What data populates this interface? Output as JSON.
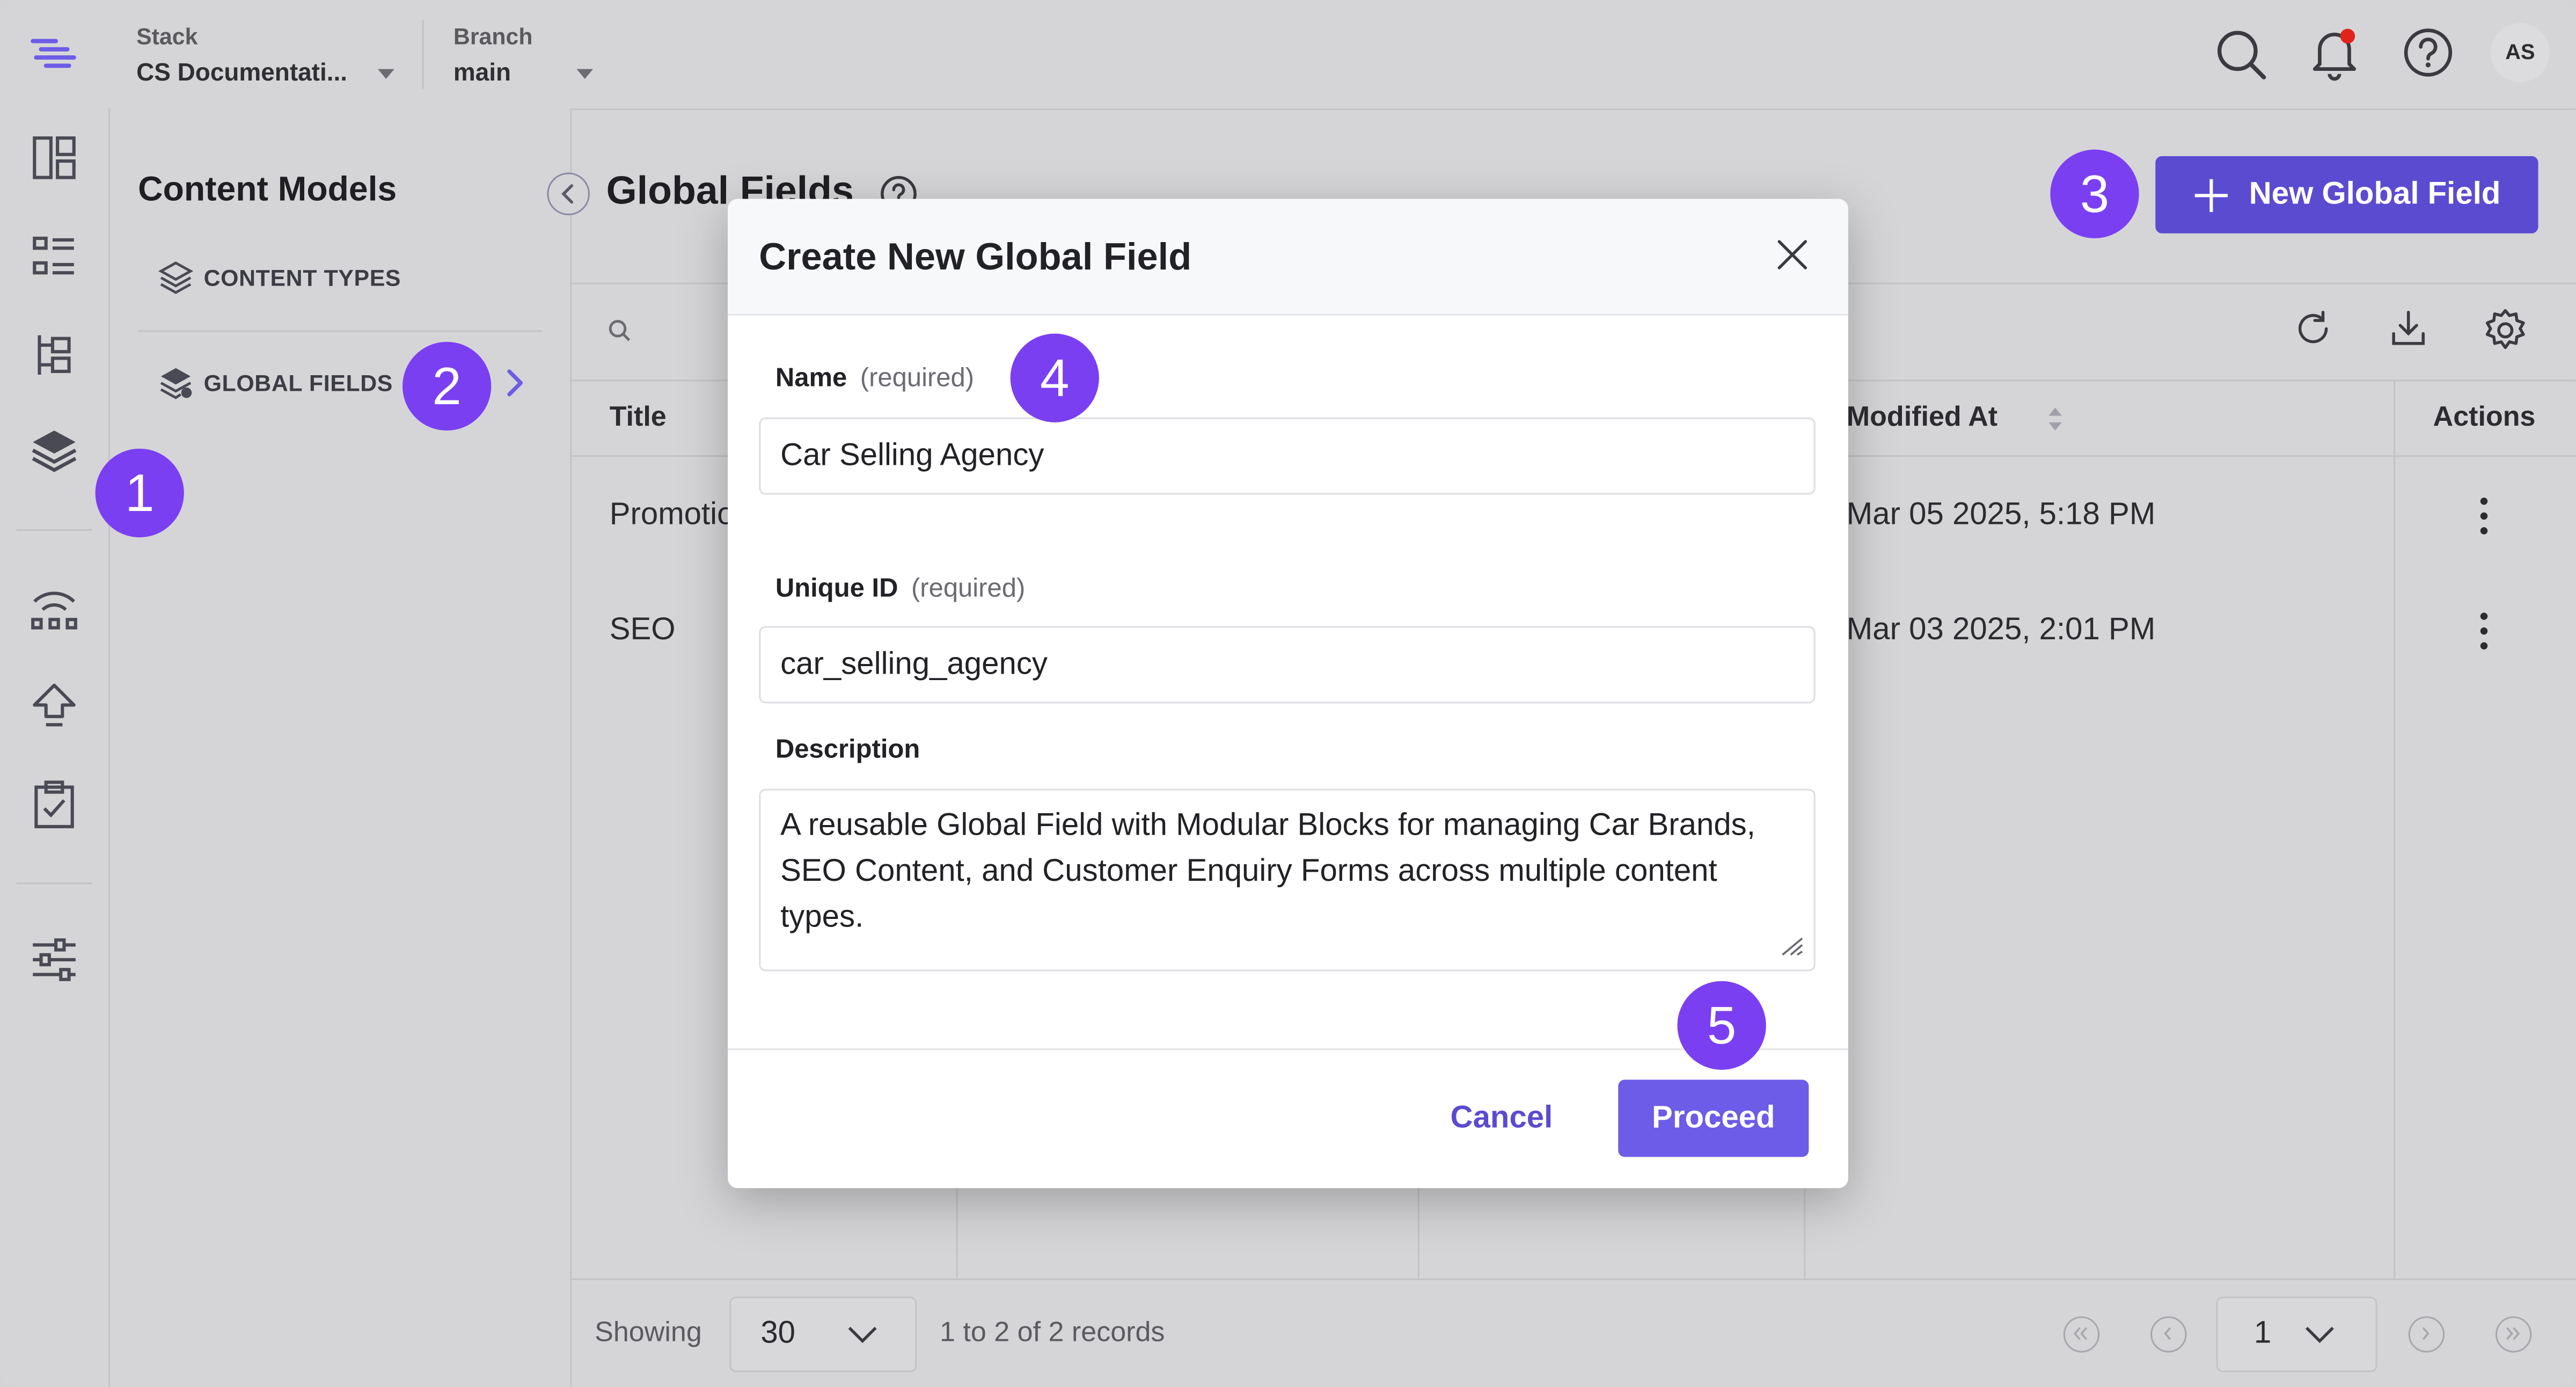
{
  "topbar": {
    "stack_label": "Stack",
    "stack_value": "CS Documentati...",
    "branch_label": "Branch",
    "branch_value": "main",
    "avatar_initials": "AS"
  },
  "sidebar": {
    "title": "Content Models",
    "items": [
      {
        "label": "CONTENT TYPES"
      },
      {
        "label": "GLOBAL FIELDS"
      }
    ]
  },
  "main": {
    "title": "Global Fields",
    "new_button_label": "New Global Field",
    "table": {
      "columns": [
        "Title",
        "Modified At",
        "Actions"
      ],
      "rows": [
        {
          "title": "Promotio",
          "modified": "Mar 05 2025, 5:18 PM"
        },
        {
          "title": "SEO",
          "modified": "Mar 03 2025, 2:01 PM"
        }
      ]
    },
    "footer": {
      "showing_label": "Showing",
      "page_size": "30",
      "records_text": "1 to 2 of 2 records",
      "page_number": "1"
    }
  },
  "modal": {
    "title": "Create New Global Field",
    "name_label": "Name",
    "name_hint": "(required)",
    "name_value": "Car Selling Agency",
    "uid_label": "Unique ID",
    "uid_hint": "(required)",
    "uid_value": "car_selling_agency",
    "description_label": "Description",
    "description_value": "A reusable Global Field with Modular Blocks for managing Car Brands, SEO Content, and Customer Enquiry Forms across multiple content types.",
    "cancel_label": "Cancel",
    "proceed_label": "Proceed"
  },
  "step_badges": [
    "1",
    "2",
    "3",
    "4",
    "5"
  ],
  "colors": {
    "accent": "#5b4bd1",
    "proceed": "#6c5ce7",
    "badge": "#7b3ff2",
    "notification_dot": "#e0241b"
  }
}
